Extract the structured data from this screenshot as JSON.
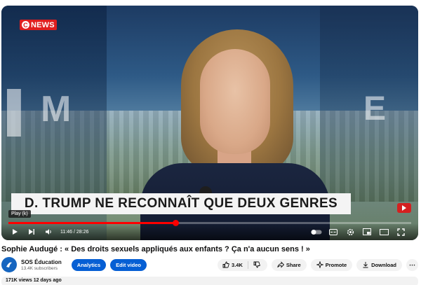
{
  "player": {
    "channel_logo": "NEWS",
    "lower_third": "D. TRUMP NE RECONNAÎT QUE DEUX GENRES",
    "tooltip": "Play (k)",
    "current_time": "11:46",
    "duration": "28:26",
    "time_display": "11:46 / 28:26",
    "progress_fraction": 0.414,
    "accent_color": "#ff0000"
  },
  "video": {
    "title": "Sophie Audugé : « Des droits sexuels appliqués aux enfants ? Ça n'a aucun sens ! »"
  },
  "channel": {
    "name": "SOS Éducation",
    "subscribers": "13.4K subscribers"
  },
  "actions": {
    "analytics": "Analytics",
    "edit_video": "Edit video",
    "likes": "3.4K",
    "share": "Share",
    "promote": "Promote",
    "download": "Download"
  },
  "description": {
    "meta": "171K views  12 days ago"
  }
}
